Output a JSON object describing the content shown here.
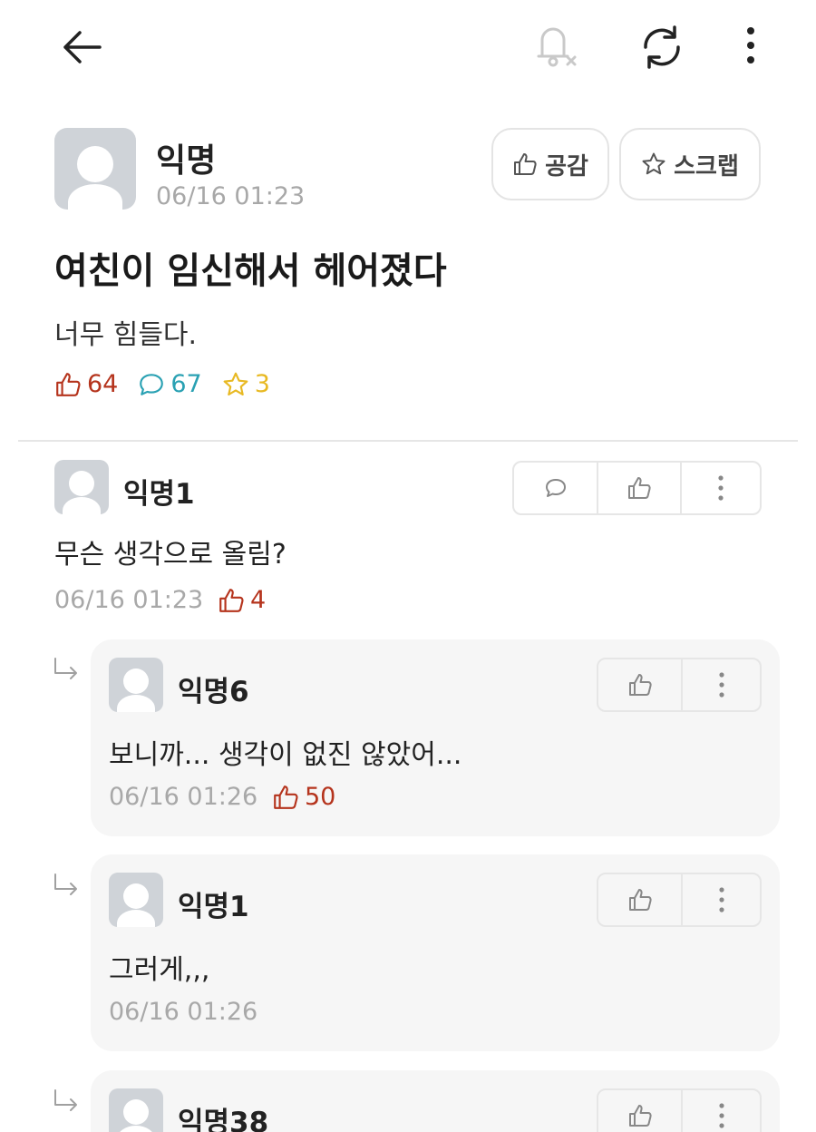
{
  "topbar": {
    "icons": [
      "back-arrow-icon",
      "bell-off-icon",
      "refresh-icon",
      "more-vertical-icon"
    ]
  },
  "post": {
    "author": "익명",
    "time": "06/16 01:23",
    "empathy_label": "공감",
    "scrap_label": "스크랩",
    "title": "여친이 임신해서 헤어졌다",
    "body": "너무 힘들다.",
    "likes": "64",
    "comments": "67",
    "scraps": "3"
  },
  "comments": [
    {
      "author": "익명1",
      "text": "무슨 생각으로 올림?",
      "time": "06/16 01:23",
      "likes": "4"
    },
    {
      "author": "익명6",
      "text": "보니까... 생각이 없진 않았어...",
      "time": "06/16 01:26",
      "likes": "50"
    },
    {
      "author": "익명1",
      "text": "그러게,,,",
      "time": "06/16 01:26"
    },
    {
      "author": "익명38"
    }
  ],
  "colors": {
    "like": "#b5341d",
    "comment": "#2aa1b3",
    "scrap": "#e8b923",
    "muted": "#a8a8a8"
  }
}
